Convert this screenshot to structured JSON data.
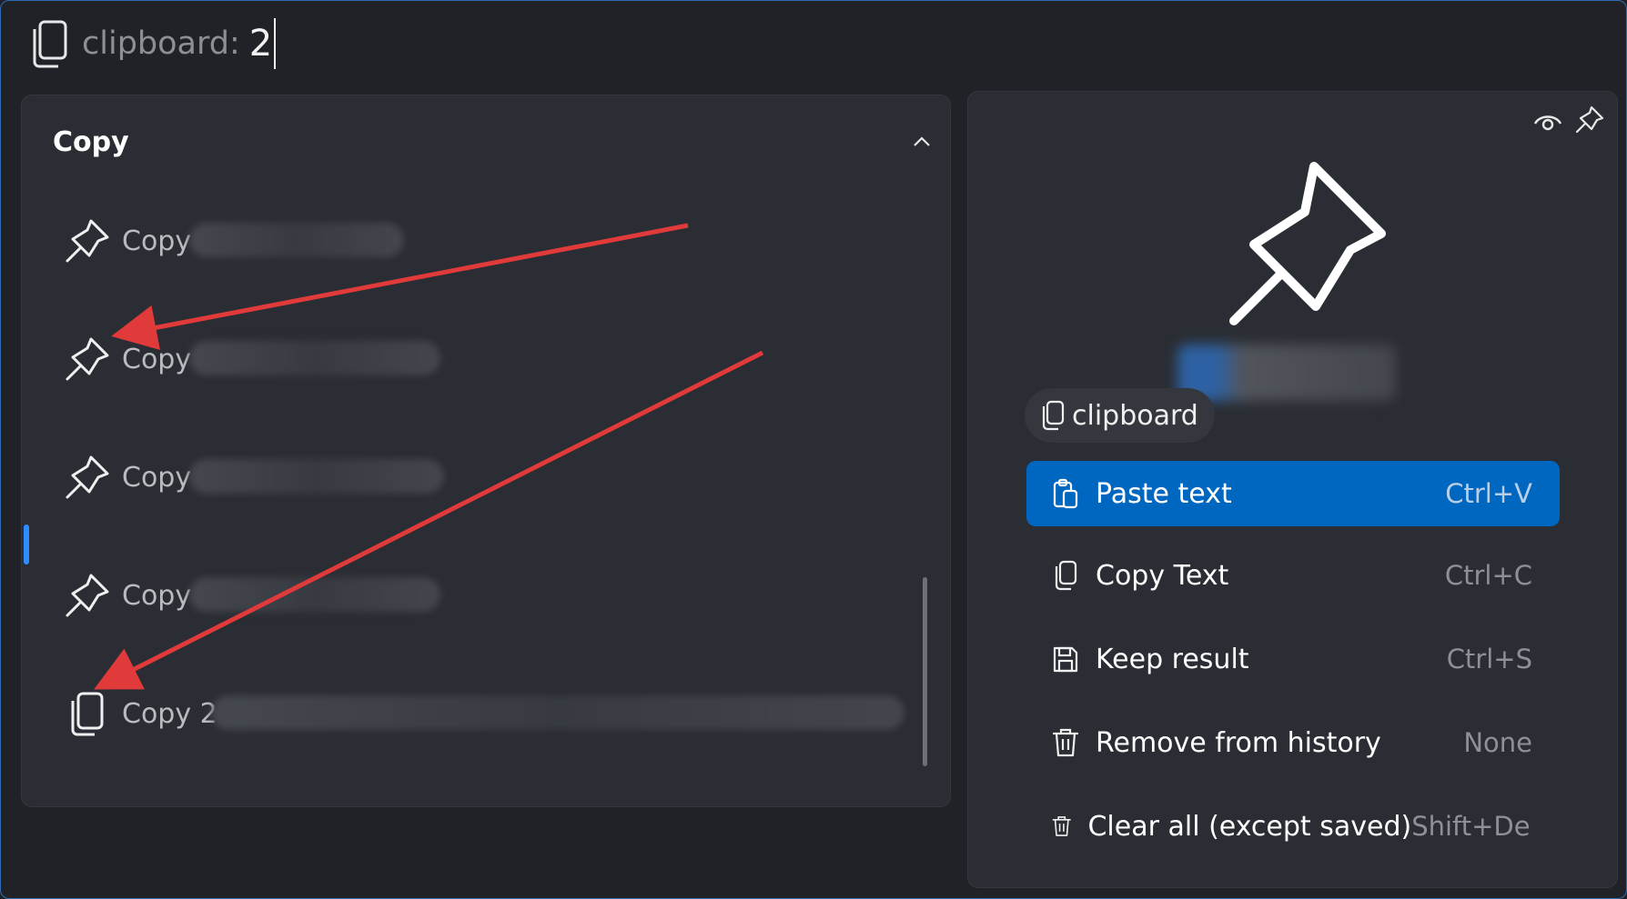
{
  "search": {
    "prefix": "clipboard:",
    "query": "2"
  },
  "results": {
    "group_title": "Copy",
    "items": [
      {
        "label": "Copy",
        "icon": "pin-icon"
      },
      {
        "label": "Copy",
        "icon": "pin-icon"
      },
      {
        "label": "Copy",
        "icon": "pin-icon"
      },
      {
        "label": "Copy",
        "icon": "pin-icon"
      },
      {
        "label": "Copy 2",
        "icon": "clipboard-icon"
      }
    ]
  },
  "details": {
    "chip_label": "clipboard",
    "actions": [
      {
        "label": "Paste text",
        "shortcut": "Ctrl+V",
        "icon": "paste-icon",
        "selected": true
      },
      {
        "label": "Copy Text",
        "shortcut": "Ctrl+C",
        "icon": "copy-icon"
      },
      {
        "label": "Keep result",
        "shortcut": "Ctrl+S",
        "icon": "save-icon"
      },
      {
        "label": "Remove from history",
        "shortcut": "None",
        "icon": "trash-icon"
      },
      {
        "label": "Clear all (except saved)",
        "shortcut": "Shift+Delete",
        "icon": "trash-icon"
      }
    ]
  },
  "colors": {
    "accent": "#0067c0",
    "annotation_arrow": "#e03a3a",
    "selection_indicator": "#2d8cff"
  }
}
